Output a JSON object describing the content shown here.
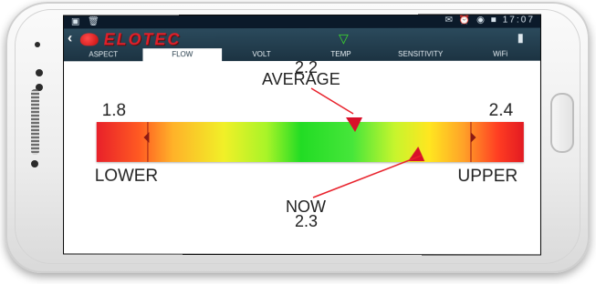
{
  "status": {
    "left_icons": "▣ 🗑",
    "right": "✉ ⏰ ◉ ■ 17:07"
  },
  "app": {
    "back": "‹",
    "brand": "ELOTEC",
    "wifi_icon": "▽",
    "mic_icon": "▮"
  },
  "tabs": [
    "ASPECT",
    "FLOW",
    "VOLT",
    "TEMP",
    "SENSITIVITY",
    "WiFi"
  ],
  "active_tab": "FLOW",
  "gauge": {
    "average_value": "2.2",
    "average_label": "AVERAGE",
    "lower_value": "1.8",
    "upper_value": "2.4",
    "lower_label": "LOWER",
    "upper_label": "UPPER",
    "now_label": "NOW",
    "now_value": "2.3"
  }
}
